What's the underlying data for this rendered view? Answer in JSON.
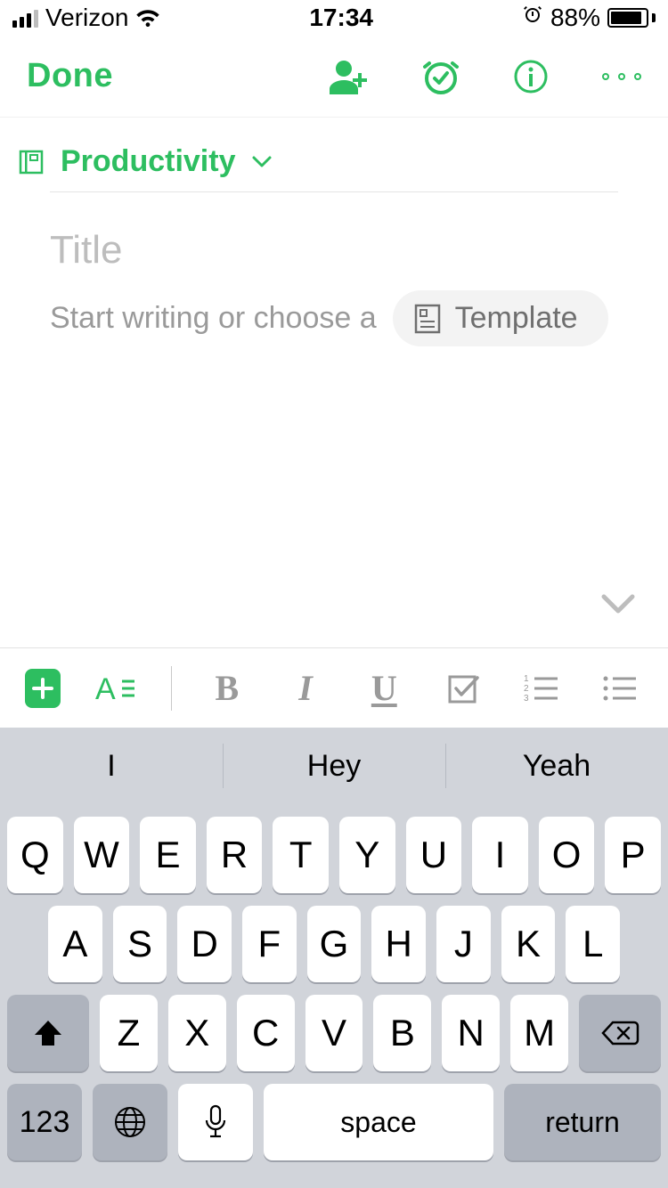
{
  "status": {
    "carrier": "Verizon",
    "time": "17:34",
    "battery_pct": "88%"
  },
  "nav": {
    "done": "Done"
  },
  "notebook": {
    "name": "Productivity"
  },
  "note": {
    "title_placeholder": "Title",
    "body_placeholder": "Start writing or choose a",
    "template_label": "Template"
  },
  "toolbar": {
    "bold": "B",
    "italic": "I",
    "underline": "U"
  },
  "keyboard": {
    "predictions": [
      "I",
      "Hey",
      "Yeah"
    ],
    "row1": [
      "Q",
      "W",
      "E",
      "R",
      "T",
      "Y",
      "U",
      "I",
      "O",
      "P"
    ],
    "row2": [
      "A",
      "S",
      "D",
      "F",
      "G",
      "H",
      "J",
      "K",
      "L"
    ],
    "row3": [
      "Z",
      "X",
      "C",
      "V",
      "B",
      "N",
      "M"
    ],
    "num_key": "123",
    "space": "space",
    "return": "return"
  }
}
